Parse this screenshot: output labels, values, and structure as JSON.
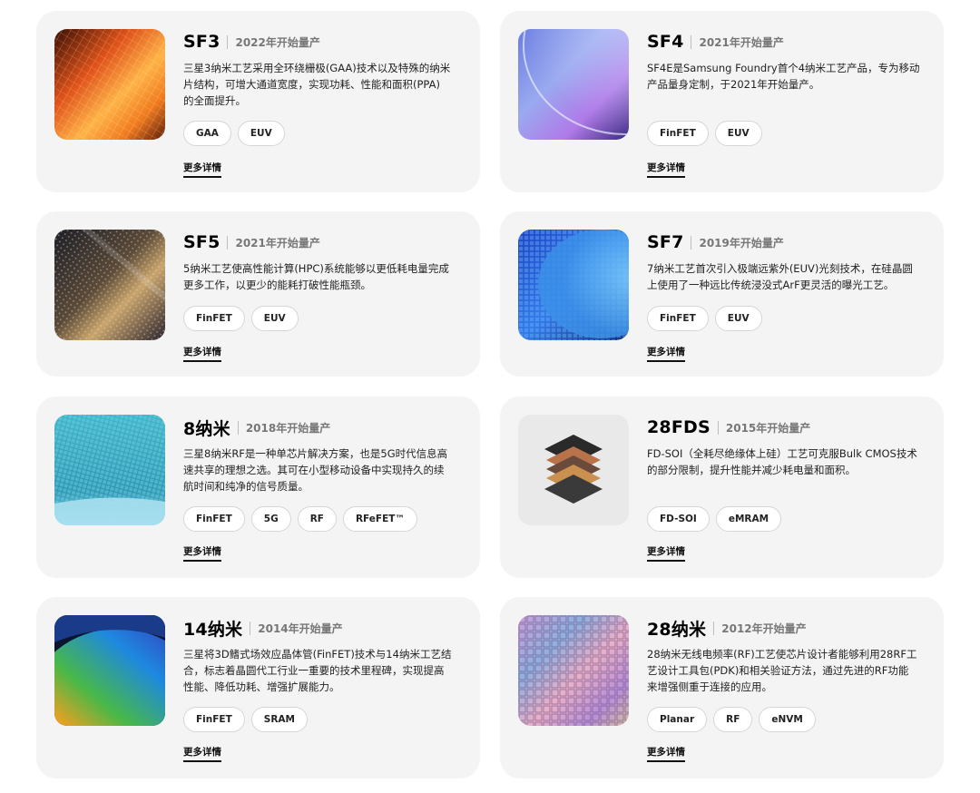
{
  "more_label": "更多详情",
  "cards": [
    {
      "node": "SF3",
      "year": "2022年开始量产",
      "desc": "三星3纳米工艺采用全环绕栅极(GAA)技术以及特殊的纳米\n片结构，可增大通道宽度，实现功耗、性能和面积(PPA)\n的全面提升。",
      "tags": [
        "GAA",
        "EUV"
      ],
      "image": "wafer-orange"
    },
    {
      "node": "SF4",
      "year": "2021年开始量产",
      "desc": "SF4E是Samsung Foundry首个4纳米工艺产品，专为移动\n产品量身定制，于2021年开始量产。",
      "tags": [
        "FinFET",
        "EUV"
      ],
      "image": "wafer-violet"
    },
    {
      "node": "SF5",
      "year": "2021年开始量产",
      "desc": "5纳米工艺使高性能计算(HPC)系统能够以更低耗电量完成\n更多工作，以更少的能耗打破性能瓶颈。",
      "tags": [
        "FinFET",
        "EUV"
      ],
      "image": "wafer-gold-dark"
    },
    {
      "node": "SF7",
      "year": "2019年开始量产",
      "desc": "7纳米工艺首次引入极端远紫外(EUV)光刻技术，在硅晶圆\n上使用了一种远比传统浸没式ArF更灵活的曝光工艺。",
      "tags": [
        "FinFET",
        "EUV"
      ],
      "image": "wafer-blue"
    },
    {
      "node": "8纳米",
      "year": "2018年开始量产",
      "desc": "三星8纳米RF是一种单芯片解决方案，也是5G时代信息高\n速共享的理想之选。其可在小型移动设备中实现持久的续\n航时间和纯净的信号质量。",
      "tags": [
        "FinFET",
        "5G",
        "RF",
        "RFeFET™"
      ],
      "image": "wafer-teal"
    },
    {
      "node": "28FDS",
      "year": "2015年开始量产",
      "desc": "FD-SOI（全耗尽绝缘体上硅）工艺可克服Bulk CMOS技术\n的部分限制，提升性能并减少耗电量和面积。",
      "tags": [
        "FD-SOI",
        "eMRAM"
      ],
      "image": "chip-layers"
    },
    {
      "node": "14纳米",
      "year": "2014年开始量产",
      "desc": "三星将3D鳍式场效应晶体管(FinFET)技术与14纳米工艺结\n合，标志着晶圆代工行业一重要的技术里程碑，实现提高\n性能、降低功耗、增强扩展能力。",
      "tags": [
        "FinFET",
        "SRAM"
      ],
      "image": "wafer-rainbow"
    },
    {
      "node": "28纳米",
      "year": "2012年开始量产",
      "desc": "28纳米无线电频率(RF)工艺使芯片设计者能够利用28RF工\n艺设计工具包(PDK)和相关验证方法，通过先进的RF功能\n来增强侧重于连接的应用。",
      "tags": [
        "Planar",
        "RF",
        "eNVM"
      ],
      "image": "wafer-grid"
    }
  ]
}
